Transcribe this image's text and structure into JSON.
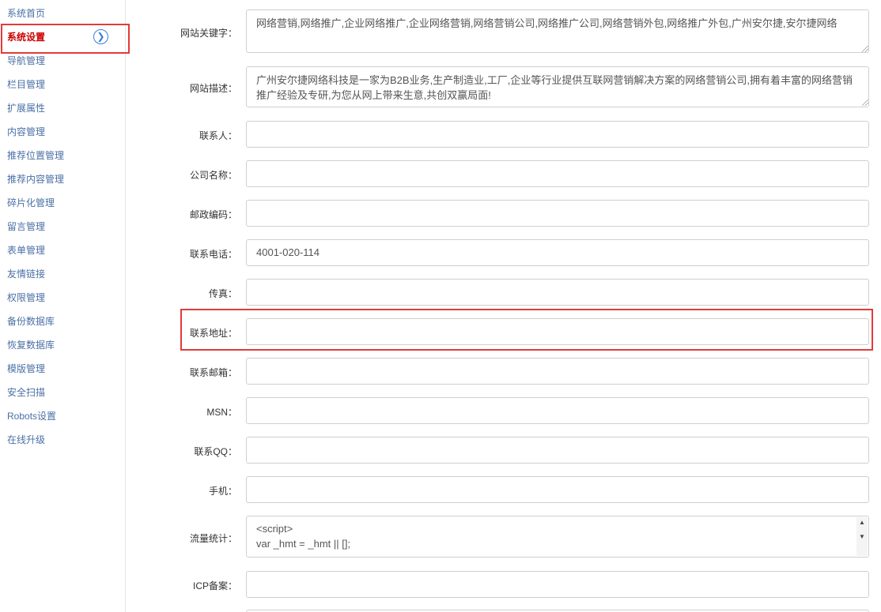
{
  "sidebar": {
    "items": [
      {
        "label": "系统首页"
      },
      {
        "label": "系统设置",
        "active": true
      },
      {
        "label": "导航管理"
      },
      {
        "label": "栏目管理"
      },
      {
        "label": "扩展属性"
      },
      {
        "label": "内容管理"
      },
      {
        "label": "推荐位置管理"
      },
      {
        "label": "推荐内容管理"
      },
      {
        "label": "碎片化管理"
      },
      {
        "label": "留言管理"
      },
      {
        "label": "表单管理"
      },
      {
        "label": "友情链接"
      },
      {
        "label": "权限管理"
      },
      {
        "label": "备份数据库"
      },
      {
        "label": "恢复数据库"
      },
      {
        "label": "模版管理"
      },
      {
        "label": "安全扫描"
      },
      {
        "label": "Robots设置"
      },
      {
        "label": "在线升级"
      }
    ],
    "active_arrow_icon": "chevron-right-circle-icon"
  },
  "form": {
    "keywords": {
      "label": "网站关键字：",
      "value": "网络营销,网络推广,企业网络推广,企业网络营销,网络营销公司,网络推广公司,网络营销外包,网络推广外包,广州安尔捷,安尔捷网络"
    },
    "description": {
      "label": "网站描述：",
      "value": "广州安尔捷网络科技是一家为B2B业务,生产制造业,工厂,企业等行业提供互联网营销解决方案的网络营销公司,拥有着丰富的网络营销推广经验及专研,为您从网上带来生意,共创双赢局面!"
    },
    "contact": {
      "label": "联系人：",
      "value": ""
    },
    "company": {
      "label": "公司名称：",
      "value": ""
    },
    "postcode": {
      "label": "邮政编码：",
      "value": ""
    },
    "phone": {
      "label": "联系电话：",
      "value": "4001-020-114"
    },
    "fax": {
      "label": "传真：",
      "value": ""
    },
    "address": {
      "label": "联系地址：",
      "value": ""
    },
    "email": {
      "label": "联系邮箱：",
      "value": ""
    },
    "msn": {
      "label": "MSN：",
      "value": ""
    },
    "qq": {
      "label": "联系QQ：",
      "value": ""
    },
    "mobile": {
      "label": "手机：",
      "value": ""
    },
    "stats": {
      "label": "流量统计：",
      "line1": "<script>",
      "line2": "var _hmt = _hmt || [];"
    },
    "icp": {
      "label": "ICP备案：",
      "value": ""
    }
  },
  "colors": {
    "highlight": "#e23b3b",
    "link": "#4a6fa5",
    "active": "#cc0000"
  }
}
